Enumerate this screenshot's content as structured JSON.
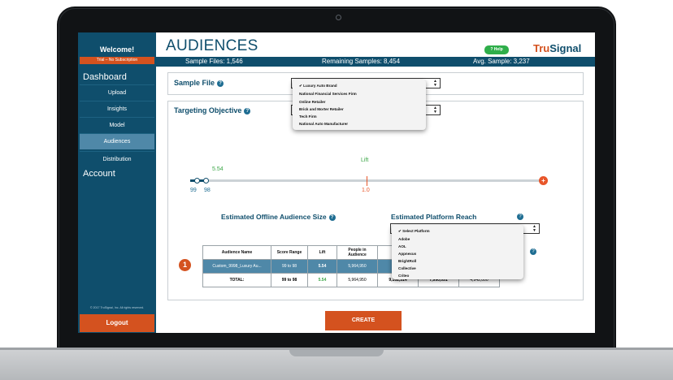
{
  "sidebar": {
    "welcome": "Welcome!",
    "trial": "Trial – No Subscription",
    "dashboard": "Dashboard",
    "items": [
      {
        "label": "Upload"
      },
      {
        "label": "Insights"
      },
      {
        "label": "Model"
      },
      {
        "label": "Audiences"
      },
      {
        "label": "Distribution"
      }
    ],
    "account": "Account",
    "copyright": "© 2017 TruSignal, Inc. All rights reserved.",
    "logout": "Logout"
  },
  "header": {
    "title": "AUDIENCES",
    "help": "Help",
    "logo_part1": "Tru",
    "logo_part2": "Signal"
  },
  "stats": {
    "sample_files": "Sample Files: 1,546",
    "remaining": "Remaining Samples: 8,454",
    "avg": "Avg. Sample: 3,237"
  },
  "sample_file": {
    "label": "Sample File",
    "options": [
      "Luxury Auto Brand",
      "National Financial Services Firm",
      "Online Retailer",
      "Brick and Morter Retailer",
      "Tech Firm",
      "National Auto Manufacturer"
    ],
    "selected_index": 0
  },
  "targeting": {
    "label": "Targeting Objective"
  },
  "slider": {
    "lift_title": "Lift",
    "lift_value": "5.54",
    "left_min": "99",
    "left_max": "98",
    "center_value": "1.0"
  },
  "offline_title": "Estimated Offline Audience Size",
  "platform_title": "Estimated Platform Reach",
  "platform_dropdown": {
    "options": [
      "Select Platform",
      "Adobe",
      "AOL",
      "Appnexus",
      "BrightRoll",
      "Collective",
      "Criteo"
    ],
    "selected_index": 0
  },
  "table": {
    "headers": [
      "Audience Name",
      "Score Range",
      "Lift",
      "People in Audience"
    ],
    "rows": [
      {
        "name": "Custom_9998_Luxury Au...",
        "range": "99 to 98",
        "lift": "5.54",
        "people": "5,964,950"
      }
    ],
    "total": {
      "label": "TOTAL:",
      "range": "99 to 98",
      "lift": "5.54",
      "people": "5,964,950",
      "reach1": "9,102,514",
      "reach2": "7,990,051",
      "reach3": "4,942,000"
    }
  },
  "badge": "1",
  "create": "CREATE",
  "colors": {
    "navy": "#0f4e6c",
    "orange": "#d4521f",
    "green": "#3aa646"
  }
}
